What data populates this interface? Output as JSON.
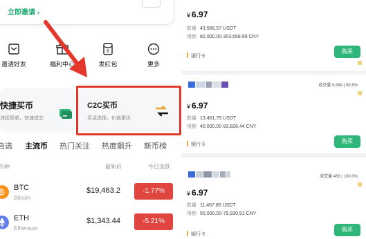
{
  "home": {
    "invite_link": "立即邀请 ›",
    "quick_actions": [
      {
        "label": "邀请好友",
        "icon": "share-icon"
      },
      {
        "label": "福利中心",
        "icon": "gift-icon"
      },
      {
        "label": "发红包",
        "icon": "red-packet-icon"
      },
      {
        "label": "更多",
        "icon": "more-icon"
      }
    ],
    "fast_buy": {
      "title": "快捷买币",
      "subtitle": "流程简单，快速成交",
      "icon": "card-icon"
    },
    "c2c_buy": {
      "title": "C2C买币",
      "subtitle": "灵活选择，价格更优",
      "icon": "exchange-icon"
    },
    "tabs": [
      "自选",
      "主流币",
      "热门关注",
      "热度飙升",
      "新币榜"
    ],
    "active_tab": "主流币",
    "table_header": {
      "coin": "币种",
      "price": "最新价",
      "change": "今日涨跌"
    },
    "coins": [
      {
        "symbol": "BTC",
        "name": "Bitcoin",
        "price": "$19,463.2",
        "change": "-1.77%",
        "icon": "bitcoin-icon",
        "color": "#f7931a"
      },
      {
        "symbol": "ETH",
        "name": "Ethereum",
        "price": "$1,343.44",
        "change": "-5.21%",
        "icon": "ethereum-icon",
        "color": "#627eea"
      }
    ],
    "down_color": "#e0453f"
  },
  "offers": [
    {
      "stats": "",
      "price": "6.97",
      "currency": "¥",
      "qty_label": "数量",
      "qty": "43,566.57 USDT",
      "limit_label": "限额",
      "limit": "80,000.00-303,658.99 CNY",
      "pay": "银行卡",
      "button": "购买"
    },
    {
      "stats": "成交量 9,549 | 99.5%",
      "price": "6.97",
      "currency": "¥",
      "qty_label": "数量",
      "qty": "13,461.75 USDT",
      "limit_label": "限额",
      "limit": "40,000.00-93,828.44 CNY",
      "pay": "银行卡",
      "button": "购买"
    },
    {
      "stats": "成交量 483 | 100.0%",
      "price": "6.97",
      "currency": "¥",
      "qty_label": "数量",
      "qty": "11,467.85 USDT",
      "limit_label": "限额",
      "limit": "50,000.00-79,930.91 CNY",
      "pay": "银行卡",
      "button": "购买"
    }
  ],
  "accent": "#2fb77a",
  "highlight_color": "#e3372b"
}
